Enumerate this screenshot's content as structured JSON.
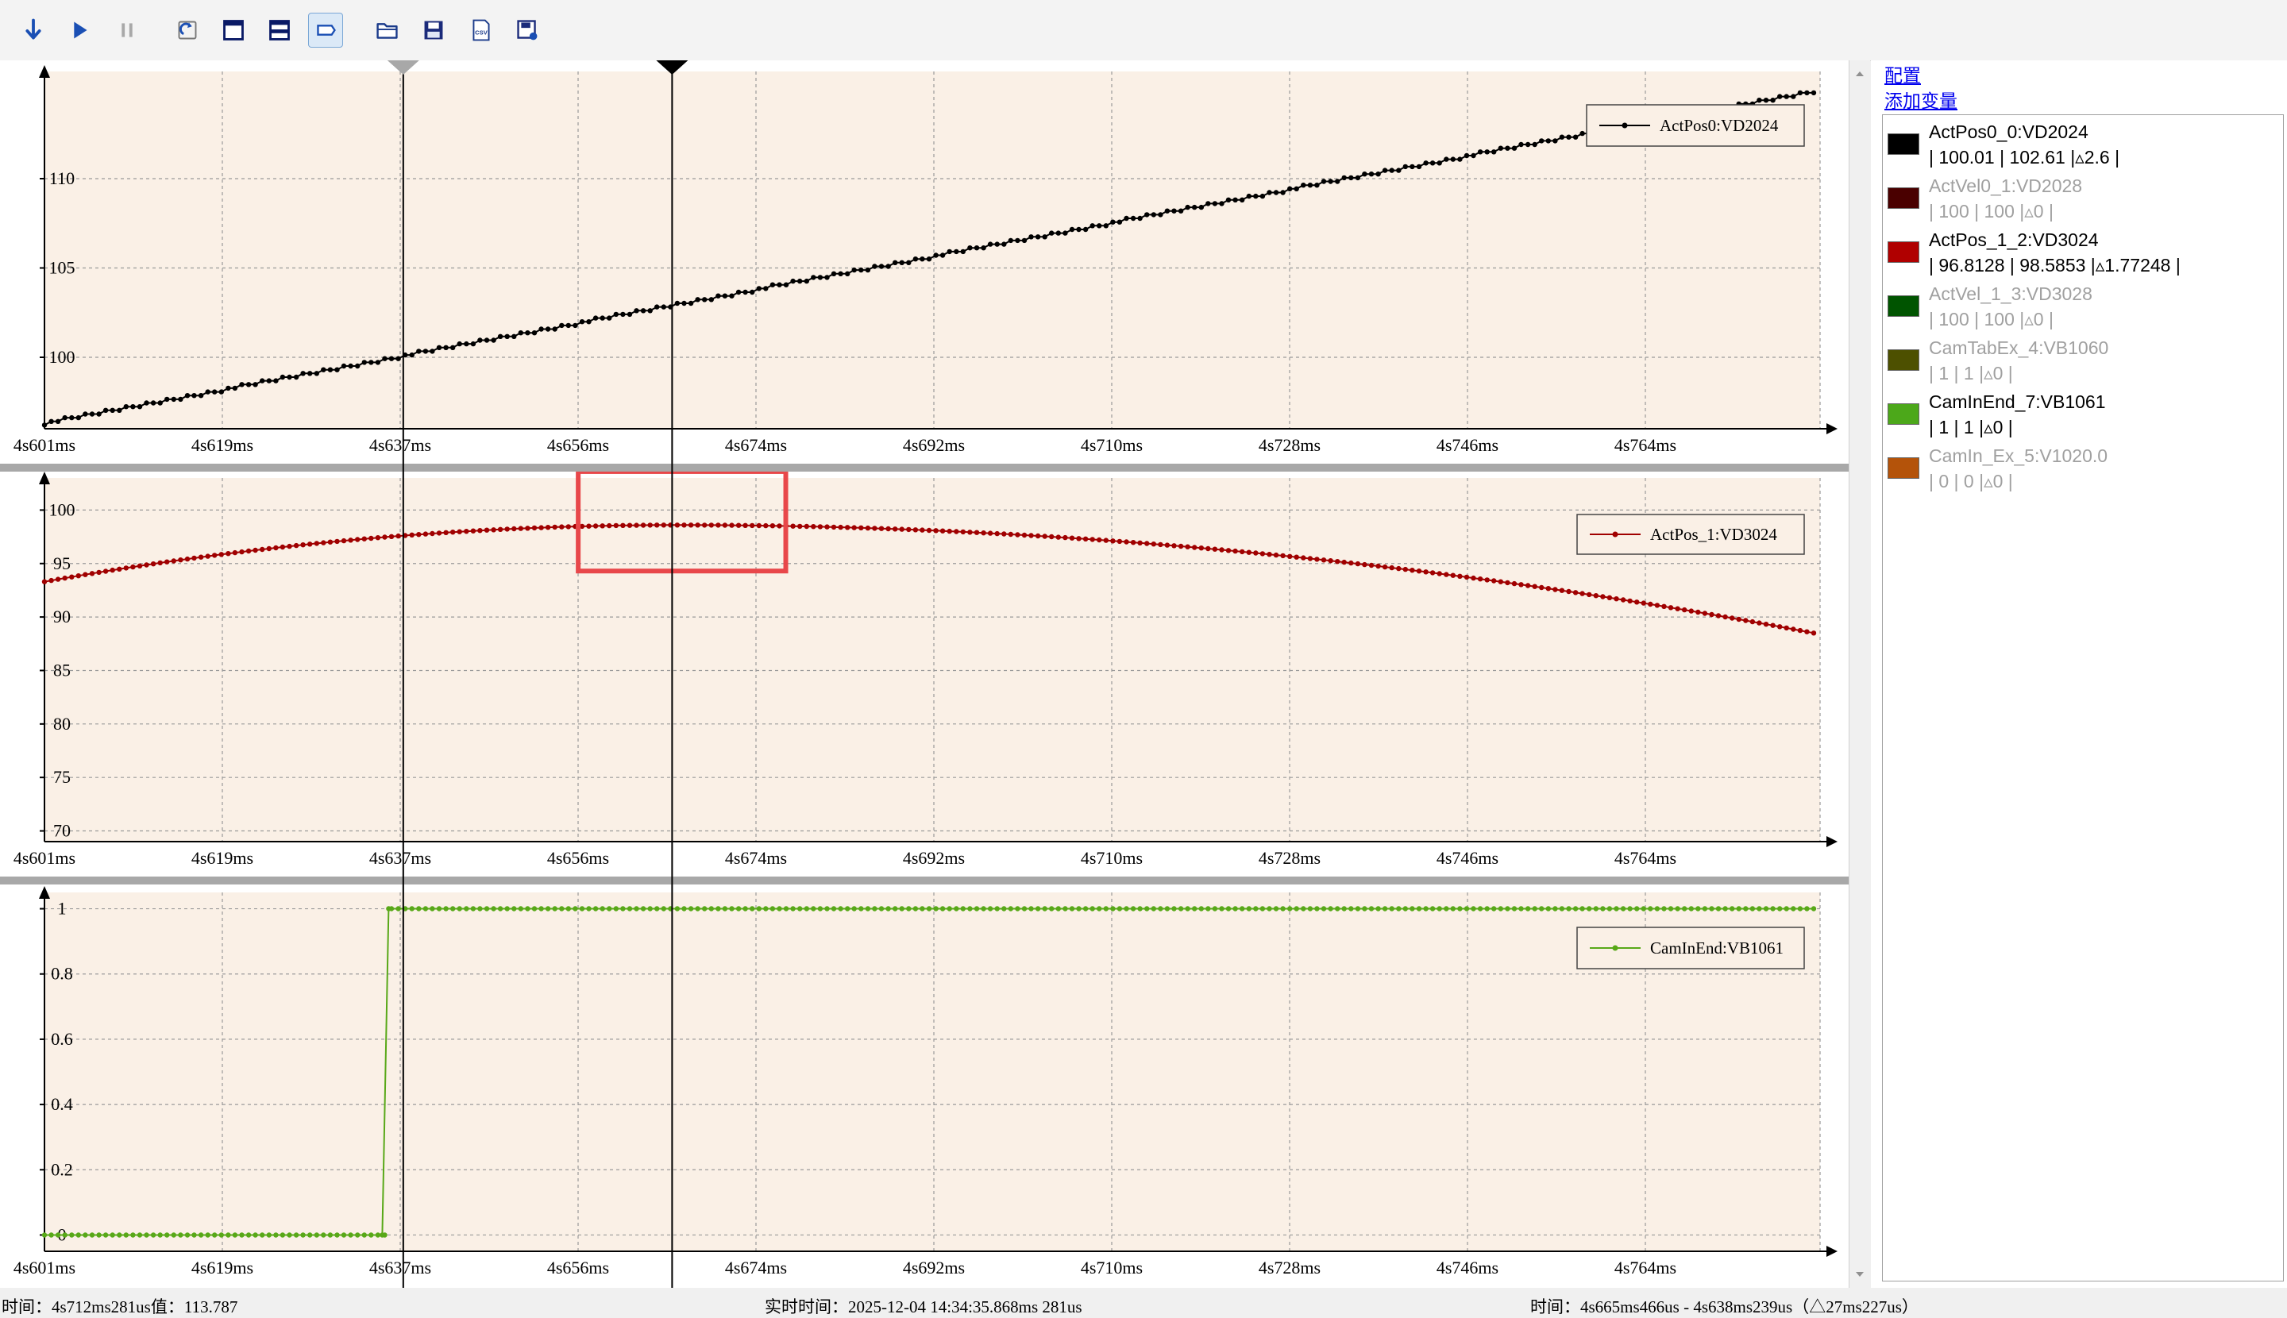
{
  "toolbar": {
    "buttons": [
      {
        "icon": "download-arrow-icon",
        "active": false
      },
      {
        "icon": "play-icon",
        "active": false
      },
      {
        "icon": "pause-icon",
        "active": false
      },
      {
        "icon": "refresh-link-icon",
        "active": false
      },
      {
        "icon": "single-window-icon",
        "active": false
      },
      {
        "icon": "split-window-icon",
        "active": false
      },
      {
        "icon": "label-tag-icon",
        "active": true
      },
      {
        "icon": "open-folder-icon",
        "active": false
      },
      {
        "icon": "save-disk-icon",
        "active": false
      },
      {
        "icon": "export-csv-icon",
        "active": false
      },
      {
        "icon": "save-settings-icon",
        "active": false
      }
    ]
  },
  "panel": {
    "config_link": "配置",
    "add_var_link": "添加变量",
    "variables": [
      {
        "name": "ActPos0_0:VD2024",
        "values": "| 100.01 | 102.61 |▵2.6 |",
        "color": "#000000",
        "enabled": true
      },
      {
        "name": "ActVel0_1:VD2028",
        "values": "| 100 | 100 |▵0 |",
        "color": "#4a0000",
        "enabled": false
      },
      {
        "name": "ActPos_1_2:VD3024",
        "values": "| 96.8128 | 98.5853 |▵1.77248 |",
        "color": "#b00000",
        "enabled": true
      },
      {
        "name": "ActVel_1_3:VD3028",
        "values": "| 100 | 100 |▵0 |",
        "color": "#005400",
        "enabled": false
      },
      {
        "name": "CamTabEx_4:VB1060",
        "values": "| 1 | 1 |▵0 |",
        "color": "#4d5000",
        "enabled": false
      },
      {
        "name": "CamInEnd_7:VB1061",
        "values": "| 1 | 1 |▵0 |",
        "color": "#4ca81a",
        "enabled": true
      },
      {
        "name": "CamIn_Ex_5:V1020.0",
        "values": "| 0 | 0 |▵0 |",
        "color": "#b4530a",
        "enabled": false
      }
    ]
  },
  "status": {
    "cursor_info": "时间：4s712ms281us值：113.787",
    "realtime": "实时时间：2025-12-04 14:34:35.868ms 281us",
    "delta": "时间：4s665ms466us - 4s638ms239us（△27ms227us）"
  },
  "colors": {
    "plot_bg": "#faf0e6",
    "sep": "#a8a8a8",
    "highlight": "#e8474a"
  },
  "chart_data": [
    {
      "type": "line",
      "legend": "ActPos0:VD2024",
      "color": "#000000",
      "x_ticks": [
        "4s601ms",
        "4s619ms",
        "4s637ms",
        "4s656ms",
        "4s674ms",
        "4s692ms",
        "4s710ms",
        "4s728ms",
        "4s746ms",
        "4s764ms"
      ],
      "y_ticks": [
        {
          "value": 100,
          "label": "100"
        },
        {
          "value": 105,
          "label": "105"
        },
        {
          "value": 110,
          "label": "110"
        }
      ],
      "ylim": [
        96,
        116
      ],
      "x_range_ms": [
        4601,
        4780
      ],
      "series": [
        {
          "x_start": 4601,
          "x_end": 4780,
          "y_start": 96.3,
          "y_end": 114.9,
          "shape": "linear"
        }
      ],
      "grid": true,
      "legend_position": "top-right"
    },
    {
      "type": "line",
      "legend": "ActPos_1:VD3024",
      "color": "#a00000",
      "x_ticks": [
        "4s601ms",
        "4s619ms",
        "4s637ms",
        "4s656ms",
        "4s674ms",
        "4s692ms",
        "4s710ms",
        "4s728ms",
        "4s746ms",
        "4s764ms"
      ],
      "y_ticks": [
        {
          "value": 70,
          "label": "70"
        },
        {
          "value": 75,
          "label": "75"
        },
        {
          "value": 80,
          "label": "80"
        },
        {
          "value": 85,
          "label": "85"
        },
        {
          "value": 90,
          "label": "90"
        },
        {
          "value": 95,
          "label": "95"
        },
        {
          "value": 100,
          "label": "100"
        }
      ],
      "ylim": [
        69,
        103
      ],
      "x_range_ms": [
        4601,
        4780
      ],
      "series": [
        {
          "shape": "parabola",
          "x_peak": 4665,
          "y_peak": 98.6,
          "x_start": 4601,
          "y_start": 93.3,
          "x_end": 4780,
          "y_end": 88.5
        }
      ],
      "grid": true,
      "legend_position": "top-right",
      "annotation": {
        "type": "highlight-box",
        "x_range_ms": [
          4655,
          4676
        ],
        "y_range": [
          94.3,
          103.6
        ]
      }
    },
    {
      "type": "line",
      "legend": "CamInEnd:VB1061",
      "color": "#58a818",
      "x_ticks": [
        "4s601ms",
        "4s619ms",
        "4s637ms",
        "4s656ms",
        "4s674ms",
        "4s692ms",
        "4s710ms",
        "4s728ms",
        "4s746ms",
        "4s764ms"
      ],
      "y_ticks": [
        {
          "value": 0,
          "label": "0"
        },
        {
          "value": 0.2,
          "label": "0.2"
        },
        {
          "value": 0.4,
          "label": "0.4"
        },
        {
          "value": 0.6,
          "label": "0.6"
        },
        {
          "value": 0.8,
          "label": "0.8"
        },
        {
          "value": 1,
          "label": "1"
        }
      ],
      "ylim": [
        -0.05,
        1.05
      ],
      "x_range_ms": [
        4601,
        4780
      ],
      "series": [
        {
          "shape": "step",
          "step_at_ms": 4635.5,
          "y_before": 0,
          "y_after": 1
        }
      ],
      "grid": true,
      "legend_position": "top-right"
    }
  ],
  "cursors": {
    "cursor1_ms": 4637.3,
    "cursor2_ms": 4664.5
  }
}
